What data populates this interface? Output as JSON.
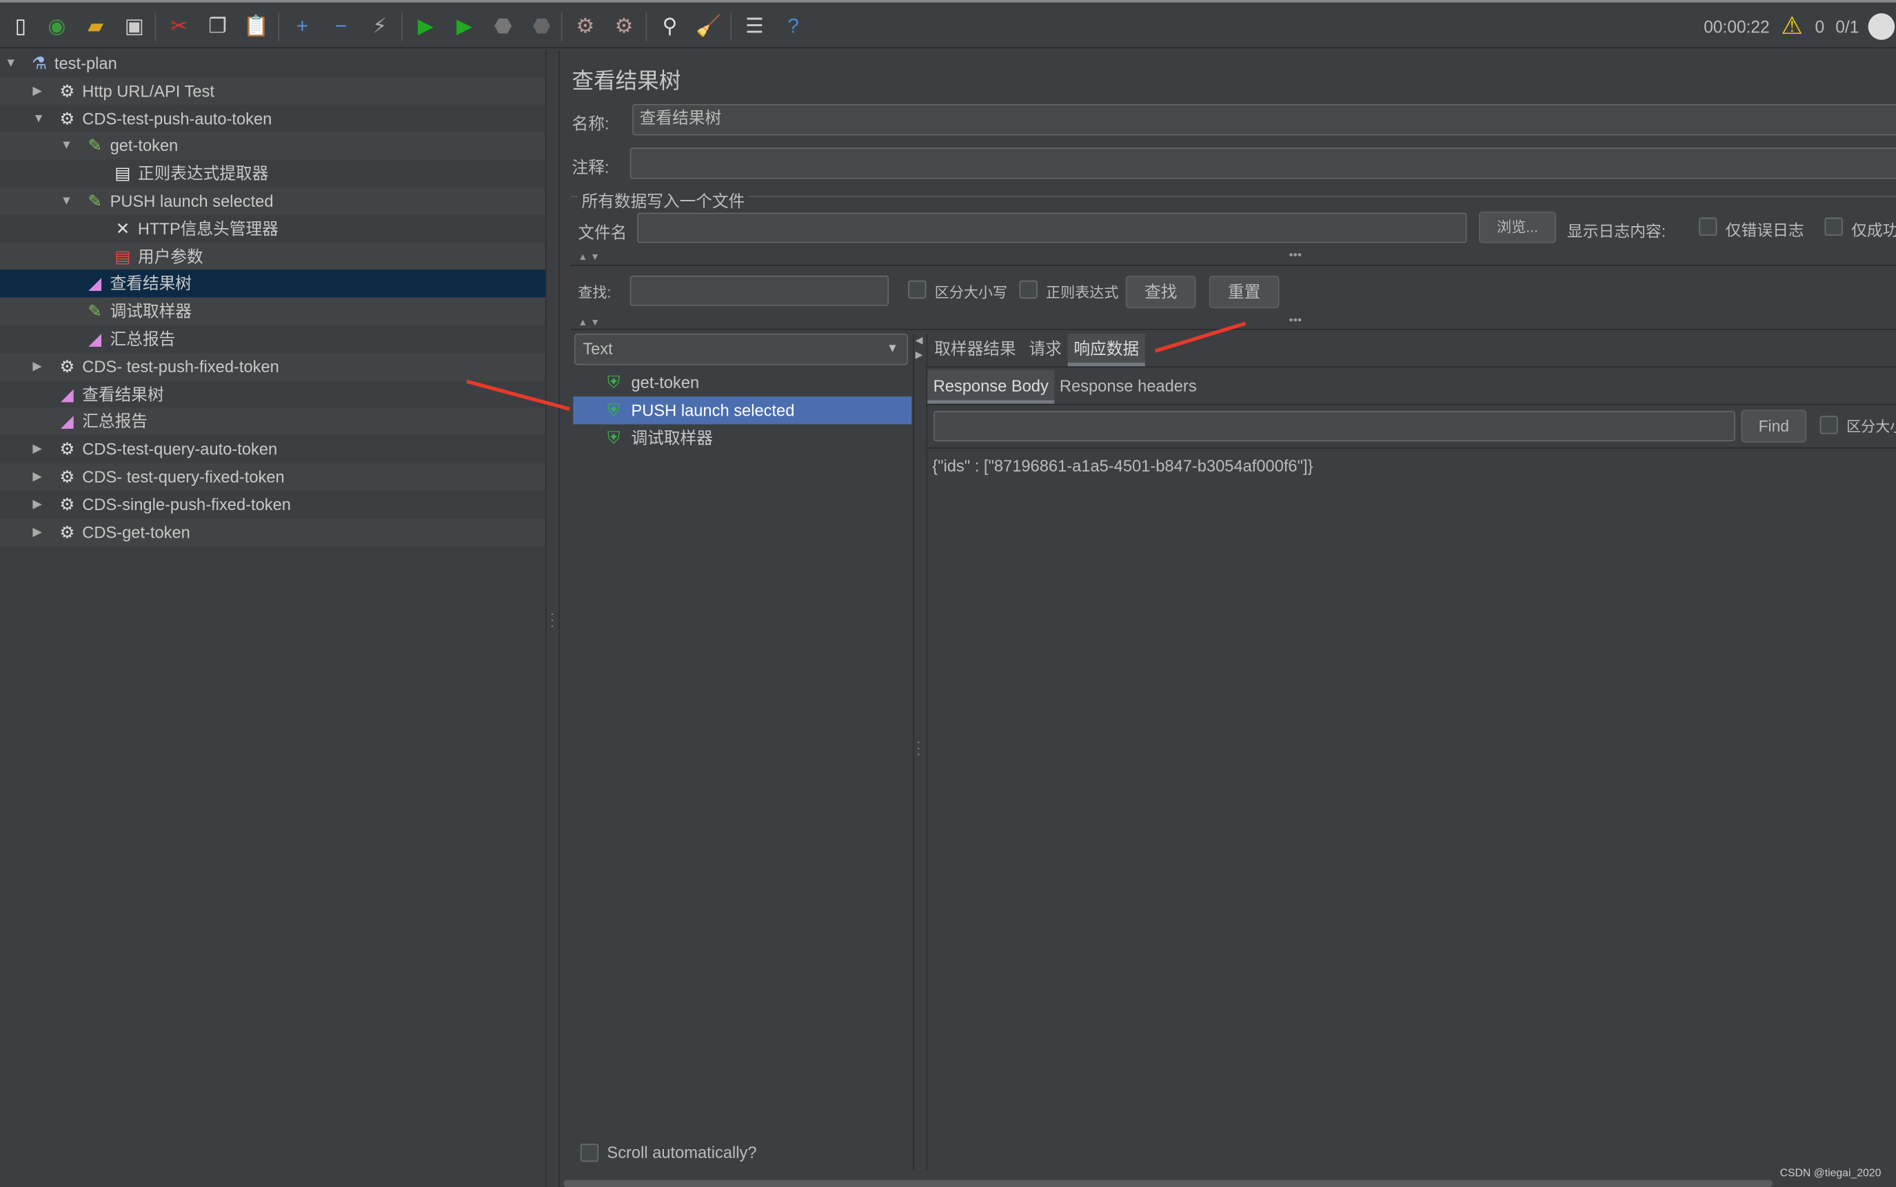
{
  "toolbar": {
    "icons": [
      "new-icon",
      "templates-icon",
      "open-icon",
      "save-icon",
      "cut-icon",
      "copy-icon",
      "paste-icon",
      "expand-icon",
      "collapse-icon",
      "toggle-icon",
      "start-icon",
      "start-no-pause-icon",
      "stop-icon",
      "shutdown-icon",
      "clear-icon",
      "clear-all-icon",
      "search-icon",
      "reset-search-icon",
      "function-helper-icon",
      "help-icon"
    ],
    "timer": "00:00:22",
    "warnings": "0",
    "threads": "0/1"
  },
  "tree": [
    {
      "label": "test-plan",
      "level": 0,
      "icon": "flask-icon",
      "expanded": true
    },
    {
      "label": "Http URL/API Test",
      "level": 1,
      "icon": "gear-icon",
      "expanded": false
    },
    {
      "label": "CDS-test-push-auto-token",
      "level": 1,
      "icon": "gear-icon",
      "expanded": true
    },
    {
      "label": "get-token",
      "level": 2,
      "icon": "pipette-icon",
      "expanded": true
    },
    {
      "label": "正则表达式提取器",
      "level": 3,
      "icon": "extractor-icon"
    },
    {
      "label": "PUSH launch selected",
      "level": 2,
      "icon": "pipette-icon",
      "expanded": true
    },
    {
      "label": "HTTP信息头管理器",
      "level": 3,
      "icon": "tools-icon"
    },
    {
      "label": "用户参数",
      "level": 3,
      "icon": "params-icon"
    },
    {
      "label": "查看结果树",
      "level": 2,
      "icon": "graph-icon",
      "selected": true
    },
    {
      "label": "调试取样器",
      "level": 2,
      "icon": "pipette-icon"
    },
    {
      "label": "汇总报告",
      "level": 2,
      "icon": "graph-icon"
    },
    {
      "label": "CDS- test-push-fixed-token",
      "level": 1,
      "icon": "gear-icon",
      "expanded": false
    },
    {
      "label": "查看结果树",
      "level": 1,
      "icon": "graph-icon"
    },
    {
      "label": "汇总报告",
      "level": 1,
      "icon": "graph-icon"
    },
    {
      "label": "CDS-test-query-auto-token",
      "level": 1,
      "icon": "gear-icon",
      "expanded": false
    },
    {
      "label": "CDS- test-query-fixed-token",
      "level": 1,
      "icon": "gear-icon",
      "expanded": false
    },
    {
      "label": "CDS-single-push-fixed-token",
      "level": 1,
      "icon": "gear-icon",
      "expanded": false
    },
    {
      "label": "CDS-get-token",
      "level": 1,
      "icon": "gear-icon",
      "expanded": false
    }
  ],
  "panel": {
    "title": "查看结果树",
    "name_label": "名称:",
    "name_value": "查看结果树",
    "comment_label": "注释:",
    "comment_value": "",
    "file_group": "所有数据写入一个文件",
    "file_label": "文件名",
    "file_value": "",
    "browse": "浏览...",
    "log_label": "显示日志内容:",
    "errors_only": "仅错误日志",
    "success_only": "仅成功",
    "search_label": "查找:",
    "search_value": "",
    "case_sensitive": "区分大小写",
    "regex": "正则表达式",
    "find": "查找",
    "reset": "重置",
    "renderer": "Text",
    "scroll_auto": "Scroll automatically?"
  },
  "results": [
    {
      "label": "get-token",
      "status": "success"
    },
    {
      "label": "PUSH launch selected",
      "status": "success",
      "selected": true
    },
    {
      "label": "调试取样器",
      "status": "success"
    }
  ],
  "tabs": [
    {
      "label": "取样器结果"
    },
    {
      "label": "请求"
    },
    {
      "label": "响应数据",
      "active": true
    }
  ],
  "subtabs": [
    {
      "label": "Response Body",
      "active": true
    },
    {
      "label": "Response headers"
    }
  ],
  "response": {
    "find": "Find",
    "case": "区分大小",
    "search_value": "",
    "body": "{\"ids\" : [\"87196861-a1a5-4501-b847-b3054af000f6\"]}"
  },
  "watermark": "CSDN @tiegai_2020",
  "colors": {
    "background": "#3c3f41",
    "selection_tree": "#0d2a45",
    "selection_list": "#4b6eaf",
    "annotation_arrow": "#e8392a"
  }
}
